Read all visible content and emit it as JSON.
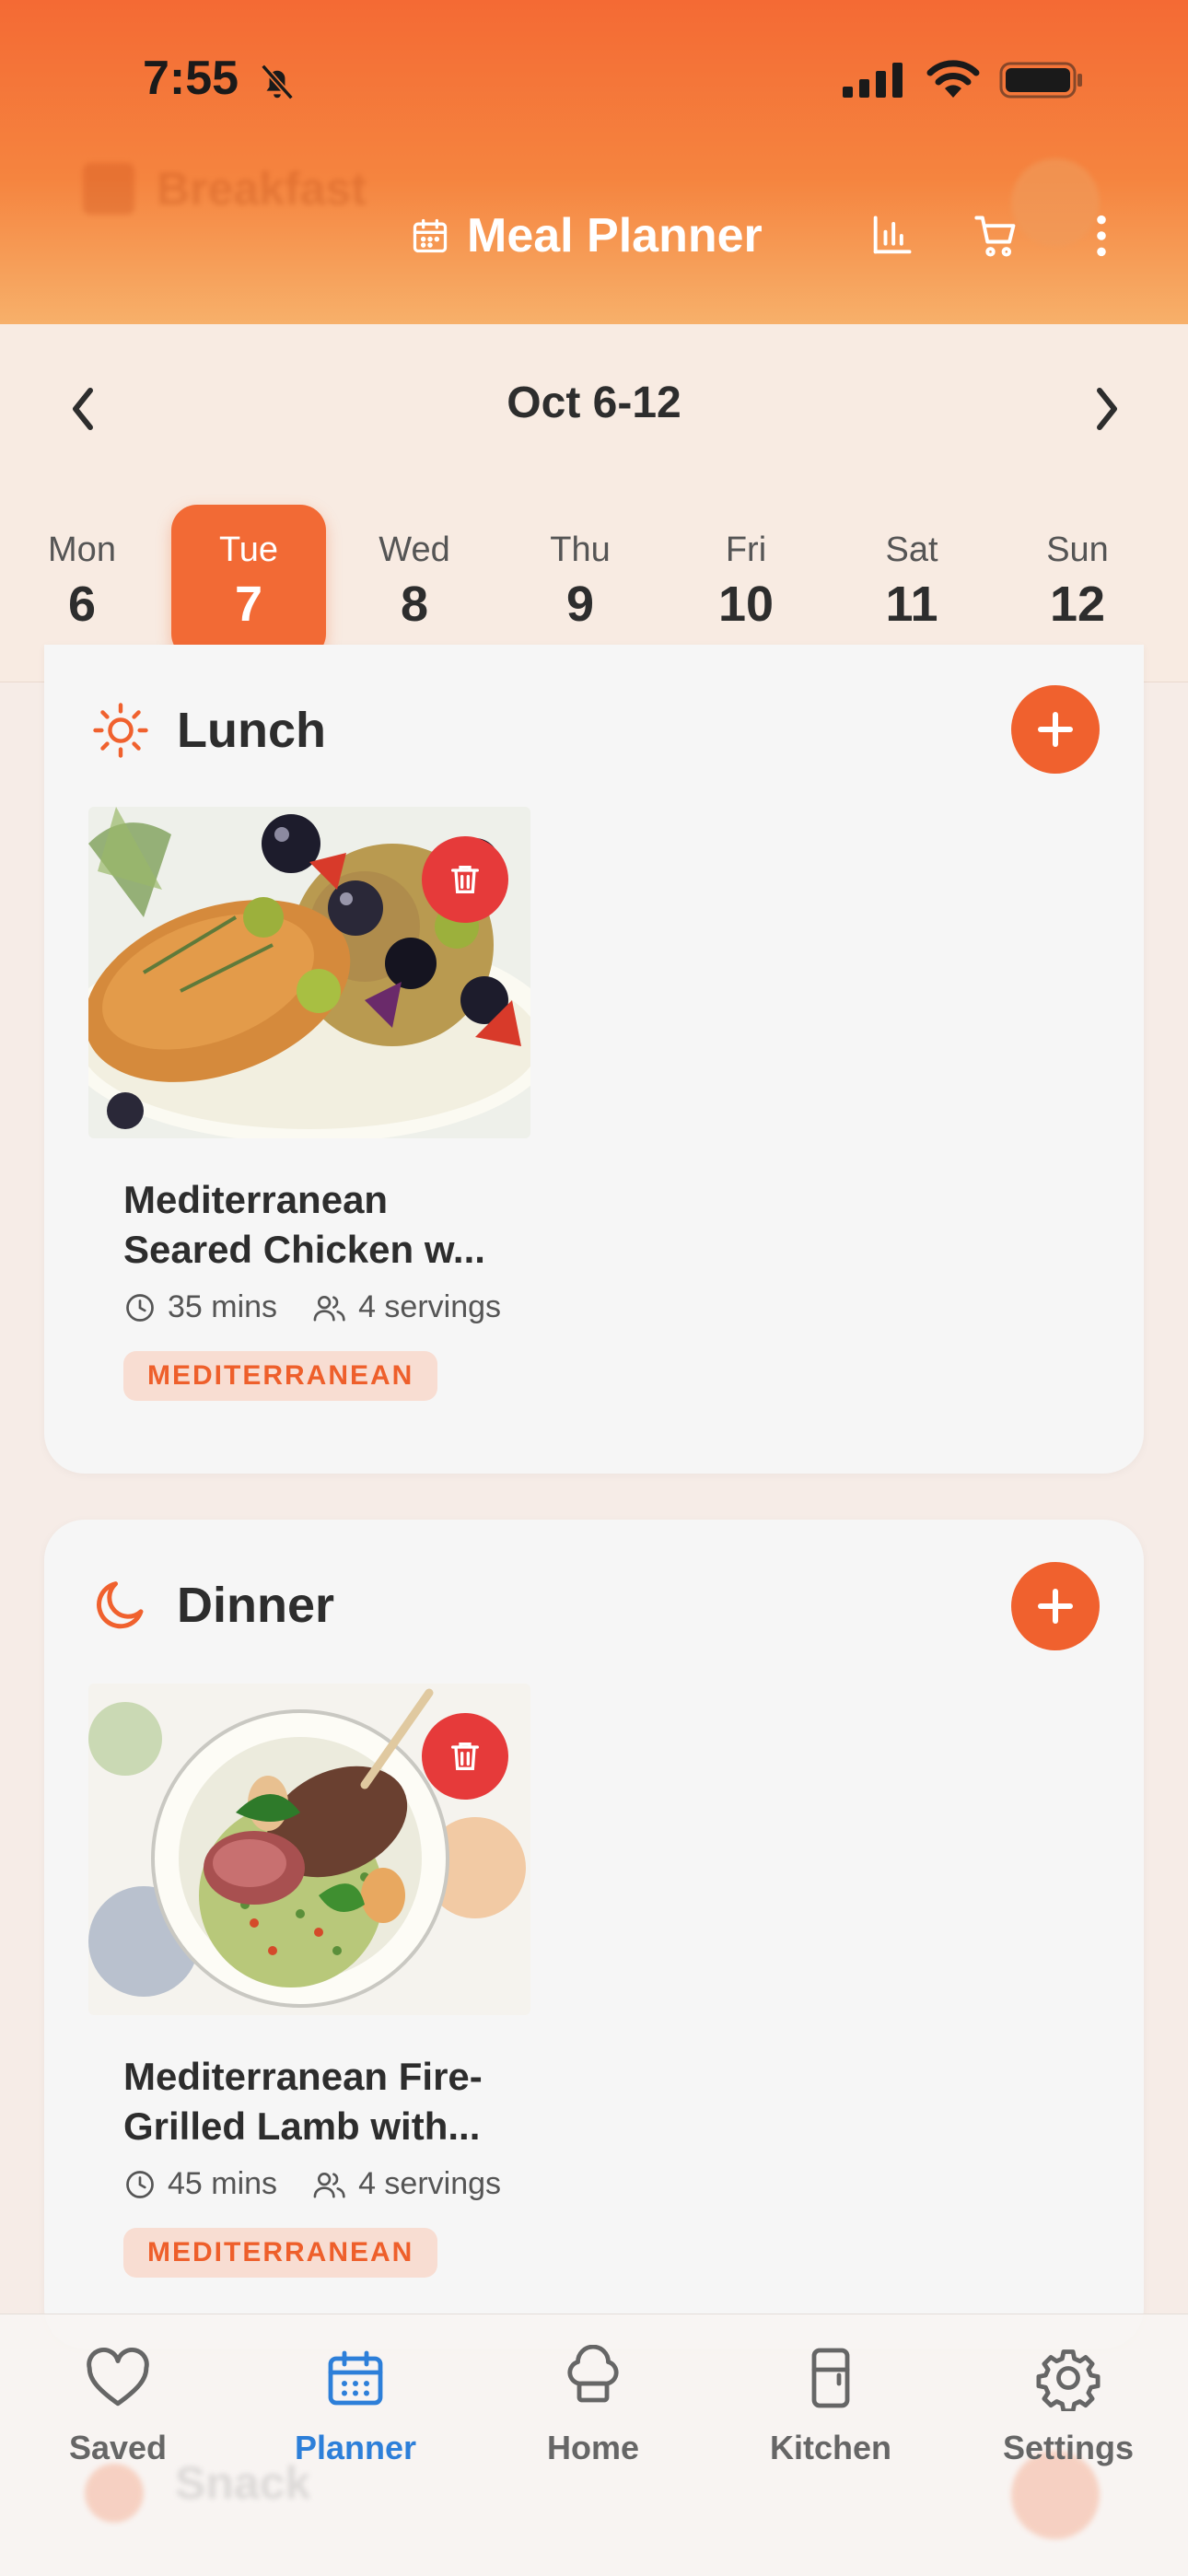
{
  "status_bar": {
    "time": "7:55"
  },
  "header": {
    "title": "Meal Planner",
    "background_meal": "Breakfast",
    "icons": [
      "calendar-icon",
      "chart-icon",
      "cart-icon",
      "more-icon"
    ]
  },
  "week": {
    "label": "Oct 6-12",
    "days": [
      {
        "name": "Mon",
        "num": "6"
      },
      {
        "name": "Tue",
        "num": "7"
      },
      {
        "name": "Wed",
        "num": "8"
      },
      {
        "name": "Thu",
        "num": "9"
      },
      {
        "name": "Fri",
        "num": "10"
      },
      {
        "name": "Sat",
        "num": "11"
      },
      {
        "name": "Sun",
        "num": "12"
      }
    ],
    "selected": "Tue"
  },
  "meals": {
    "lunch": {
      "title": "Lunch",
      "recipe": {
        "name": "Mediterranean Seared Chicken w...",
        "time": "35 mins",
        "servings": "4 servings",
        "tag": "MEDITERRANEAN"
      }
    },
    "dinner": {
      "title": "Dinner",
      "recipe": {
        "name": "Mediterranean Fire-Grilled Lamb with...",
        "time": "45 mins",
        "servings": "4 servings",
        "tag": "MEDITERRANEAN"
      }
    },
    "snack": {
      "title": "Snack"
    }
  },
  "tabs": [
    {
      "label": "Saved",
      "icon": "heart-icon"
    },
    {
      "label": "Planner",
      "icon": "calendar-icon"
    },
    {
      "label": "Home",
      "icon": "chef-hat-icon"
    },
    {
      "label": "Kitchen",
      "icon": "fridge-icon"
    },
    {
      "label": "Settings",
      "icon": "gear-icon"
    }
  ],
  "colors": {
    "accent": "#f26a35",
    "delete": "#e63a3a",
    "active_tab": "#2d7fd9",
    "tag_bg": "#f8ddd2"
  }
}
